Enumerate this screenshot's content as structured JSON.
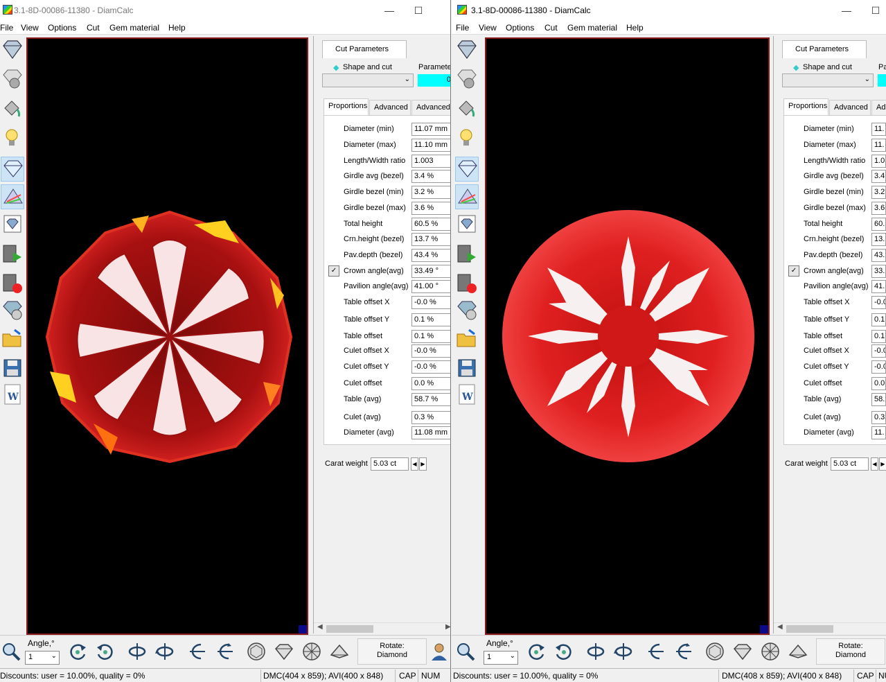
{
  "windows": [
    {
      "title": "3.1-8D-00086-11380 - DiamCalc",
      "menu": [
        "File",
        "View",
        "Options",
        "Cut",
        "Gem material",
        "Help"
      ],
      "cut_parameters_tab": "Cut Parameters",
      "shape_and_cut_label": "Shape and cut",
      "parameter_label": "Parameter",
      "parameter_value": "0",
      "tabs": [
        "Proportions",
        "Advanced",
        "Advanced"
      ],
      "proportions": [
        {
          "label": "Diameter (min)",
          "value": "11.07 mm"
        },
        {
          "label": "Diameter (max)",
          "value": "11.10 mm"
        },
        {
          "label": "Length/Width ratio",
          "value": "1.003"
        },
        {
          "label": "Girdle avg (bezel)",
          "value": "3.4 %"
        },
        {
          "label": "Girdle bezel (min)",
          "value": "3.2 %"
        },
        {
          "label": "Girdle bezel (max)",
          "value": "3.6 %"
        },
        {
          "label": "Total height",
          "value": "60.5 %"
        },
        {
          "label": "Crn.height (bezel)",
          "value": "13.7 %"
        },
        {
          "label": "Pav.depth (bezel)",
          "value": "43.4 %"
        },
        {
          "label": "Crown angle(avg)",
          "value": "33.49 °"
        },
        {
          "label": "Pavilion angle(avg)",
          "value": "41.00 °"
        },
        {
          "label": "Table offset X",
          "value": "-0.0 %"
        },
        {
          "label": "Table offset Y",
          "value": "0.1 %"
        },
        {
          "label": "Table offset",
          "value": "0.1 %"
        },
        {
          "label": "Culet offset X",
          "value": "-0.0 %"
        },
        {
          "label": "Culet offset Y",
          "value": "-0.0 %"
        },
        {
          "label": "Culet offset",
          "value": "0.0 %"
        },
        {
          "label": "Table (avg)",
          "value": "58.7 %"
        },
        {
          "label": "Culet (avg)",
          "value": "0.3 %"
        },
        {
          "label": "Diameter (avg)",
          "value": "11.08 mm"
        }
      ],
      "carat_label": "Carat weight",
      "carat_value": "5.03 ct",
      "angle_label": "Angle,°",
      "angle_value": "1",
      "rotate_label": "Rotate:",
      "rotate_value": "Diamond",
      "status_discounts": "Discounts: user = 10.00%, quality = 0%",
      "status_dmc": "DMC(404 x 859); AVI(400 x 848)",
      "status_cap": "CAP",
      "status_num": "NUM"
    },
    {
      "title": "3.1-8D-00086-11380 - DiamCalc",
      "menu": [
        "File",
        "View",
        "Options",
        "Cut",
        "Gem material",
        "Help"
      ],
      "cut_parameters_tab": "Cut Parameters",
      "shape_and_cut_label": "Shape and cut",
      "parameter_label": "Pa",
      "tabs": [
        "Proportions",
        "Advanced",
        "Ad"
      ],
      "proportions": [
        {
          "label": "Diameter (min)",
          "value": "11."
        },
        {
          "label": "Diameter (max)",
          "value": "11."
        },
        {
          "label": "Length/Width ratio",
          "value": "1.0"
        },
        {
          "label": "Girdle avg (bezel)",
          "value": "3.4"
        },
        {
          "label": "Girdle bezel (min)",
          "value": "3.2"
        },
        {
          "label": "Girdle bezel (max)",
          "value": "3.6"
        },
        {
          "label": "Total height",
          "value": "60."
        },
        {
          "label": "Crn.height (bezel)",
          "value": "13."
        },
        {
          "label": "Pav.depth (bezel)",
          "value": "43."
        },
        {
          "label": "Crown angle(avg)",
          "value": "33."
        },
        {
          "label": "Pavilion angle(avg)",
          "value": "41."
        },
        {
          "label": "Table offset X",
          "value": "-0.0"
        },
        {
          "label": "Table offset Y",
          "value": "0.1"
        },
        {
          "label": "Table offset",
          "value": "0.1"
        },
        {
          "label": "Culet offset X",
          "value": "-0.0"
        },
        {
          "label": "Culet offset Y",
          "value": "-0.0"
        },
        {
          "label": "Culet offset",
          "value": "0.0"
        },
        {
          "label": "Table (avg)",
          "value": "58."
        },
        {
          "label": "Culet (avg)",
          "value": "0.3"
        },
        {
          "label": "Diameter (avg)",
          "value": "11."
        }
      ],
      "carat_label": "Carat weight",
      "carat_value": "5.03 ct",
      "angle_label": "Angle,°",
      "angle_value": "1",
      "rotate_label": "Rotate:",
      "rotate_value": "Diamond",
      "status_discounts": "Discounts: user = 10.00%, quality = 0%",
      "status_dmc": "DMC(408 x 859); AVI(400 x 848)",
      "status_cap": "CAP",
      "status_num": "NU"
    }
  ],
  "left_tools": [
    "diamond-icon",
    "ball-icon",
    "paint-bucket-icon",
    "bulb-icon",
    "sparkle-diamond-icon",
    "prism-icon",
    "image-diamond-icon",
    "video-play-icon",
    "video-record-icon",
    "stone-settings-icon",
    "open-folder-icon",
    "save-icon",
    "word-icon"
  ],
  "bottom_tools": [
    "zoom-icon",
    "rotate-ccw-icon",
    "rotate-cw-icon",
    "flip-horizontal-icon",
    "flip-horizontal-back-icon",
    "tilt-left-icon",
    "tilt-right-icon",
    "top-view-icon",
    "side-view-icon",
    "bottom-view-icon",
    "profile-view-icon"
  ],
  "colors": {
    "view_border": "#8b1a1a",
    "cyan": "#00ffff",
    "stone_red": "#cc1111"
  }
}
